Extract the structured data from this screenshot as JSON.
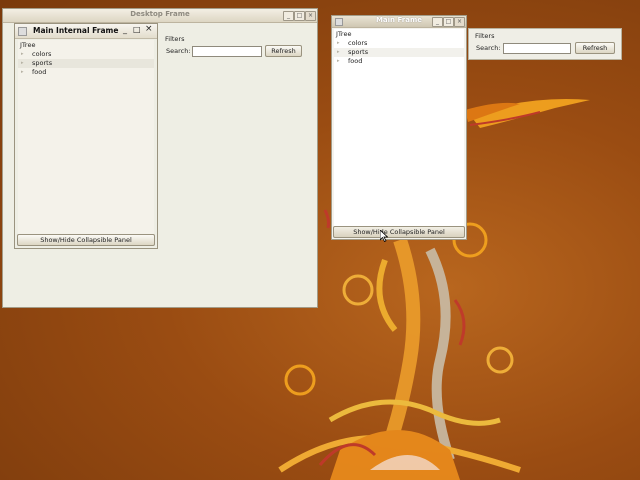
{
  "desktop_frame": {
    "title": "Desktop Frame",
    "internal_frame": {
      "title": "Main Internal Frame",
      "tree_root": "JTree",
      "tree_items": [
        "colors",
        "sports",
        "food"
      ],
      "toggle_button": "Show/Hide Collapsible Panel"
    },
    "filters": {
      "heading": "Filters",
      "search_label": "Search:",
      "search_value": "",
      "refresh_button": "Refresh"
    }
  },
  "main_frame": {
    "title": "Main Frame",
    "tree_root": "JTree",
    "tree_items": [
      "colors",
      "sports",
      "food"
    ],
    "toggle_button": "Show/Hide Collapsible Panel"
  },
  "filters_panel": {
    "heading": "Filters",
    "search_label": "Search:",
    "search_value": "",
    "refresh_button": "Refresh"
  },
  "window_controls": {
    "minimize": "_",
    "maximize": "□",
    "close": "×"
  },
  "colors": {
    "wallpaper": "#9a4c12",
    "wallpaper_accent": "#e8951e",
    "window_bg": "#eeeee4"
  }
}
